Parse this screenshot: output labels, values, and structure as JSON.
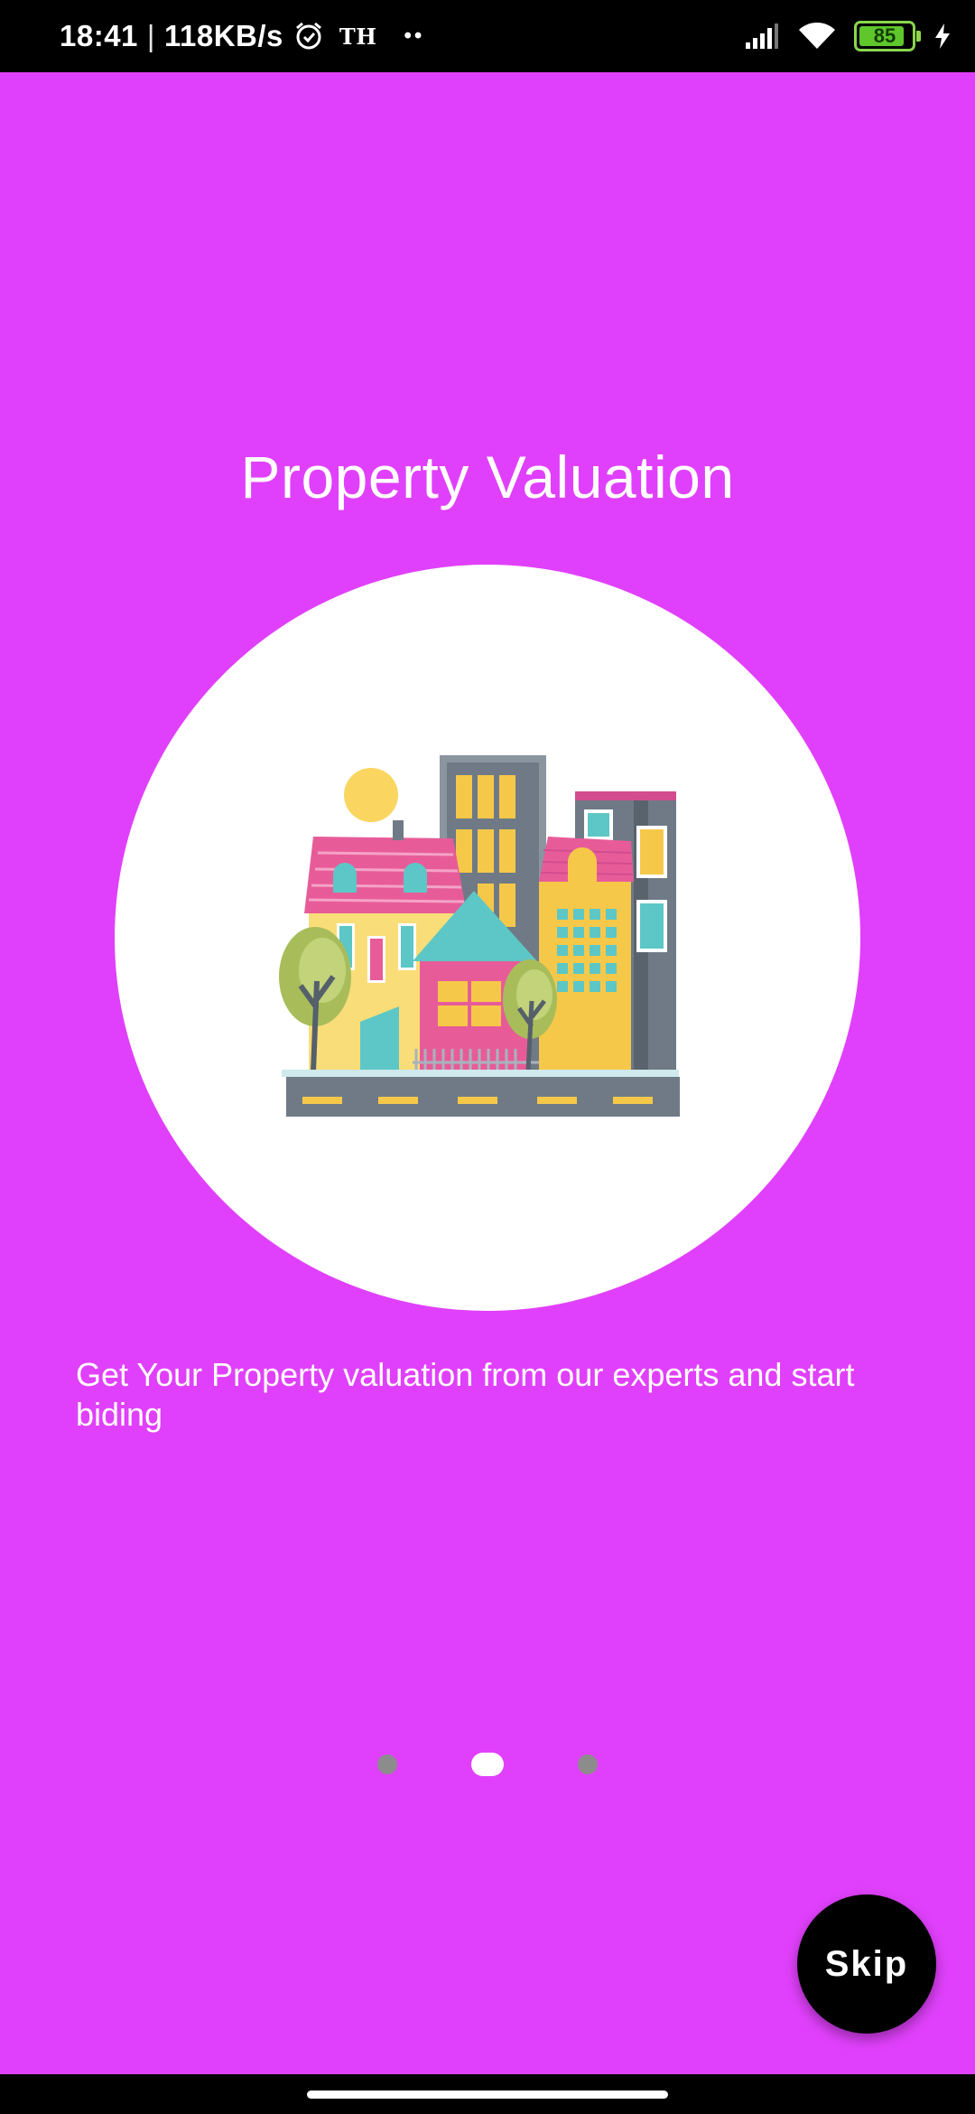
{
  "status_bar": {
    "time": "18:41",
    "separator": "|",
    "net_speed": "118KB/s",
    "carrier_badge": "TH",
    "dots": "••",
    "battery_level": "85",
    "icons": [
      "alarm-icon",
      "signal-icon",
      "wifi-icon",
      "battery-icon",
      "charging-icon"
    ]
  },
  "onboarding": {
    "title": "Property Valuation",
    "illustration": "city-buildings-illustration",
    "description": "Get Your Property valuation from our experts and start biding",
    "page_indicator": {
      "total": 3,
      "active_index": 1
    },
    "skip_label": "Skip"
  },
  "colors": {
    "background": "#E040FB",
    "circle": "#FFFFFF",
    "skip_button": "#000000",
    "indicator_inactive": "#8C8C8C",
    "indicator_active": "#FFFFFF"
  }
}
